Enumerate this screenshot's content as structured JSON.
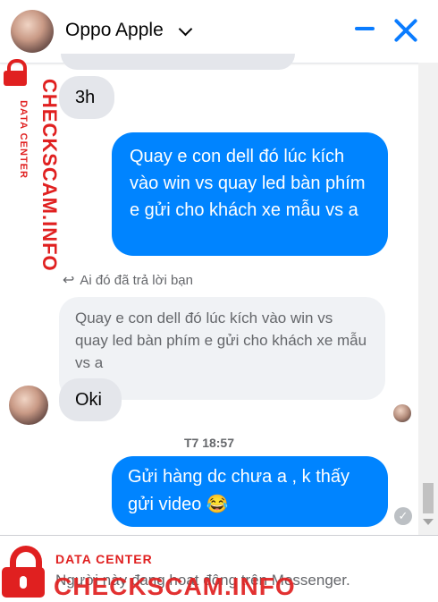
{
  "header": {
    "contact_name": "Oppo Apple"
  },
  "messages": {
    "incoming_1": "3h",
    "outgoing_1": "Quay e con dell đó lúc kích vào win vs quay led bàn phím e gửi cho khách xe mẫu vs a",
    "reply_notice": "Ai đó đã trả lời bạn",
    "quoted": "Quay e con dell đó lúc kích vào win vs quay led bàn phím e gửi cho khách xe mẫu vs a",
    "incoming_2": "Oki",
    "timestamp": "T7 18:57",
    "outgoing_2": "Gửi hàng dc chưa a , k thấy gửi video 😂"
  },
  "footer": {
    "notice": "Người này đang hoạt động trên Messenger."
  },
  "watermark": {
    "brand": "CHECKSCAM.INFO",
    "subtitle": "DATA CENTER"
  },
  "colors": {
    "accent": "#0084ff",
    "header_icons": "#0a7cff",
    "watermark": "#e02020"
  },
  "icons": [
    "chevron-down-icon",
    "minimize-icon",
    "close-icon",
    "reply-arrow-icon",
    "seen-check-icon",
    "lock-icon"
  ]
}
